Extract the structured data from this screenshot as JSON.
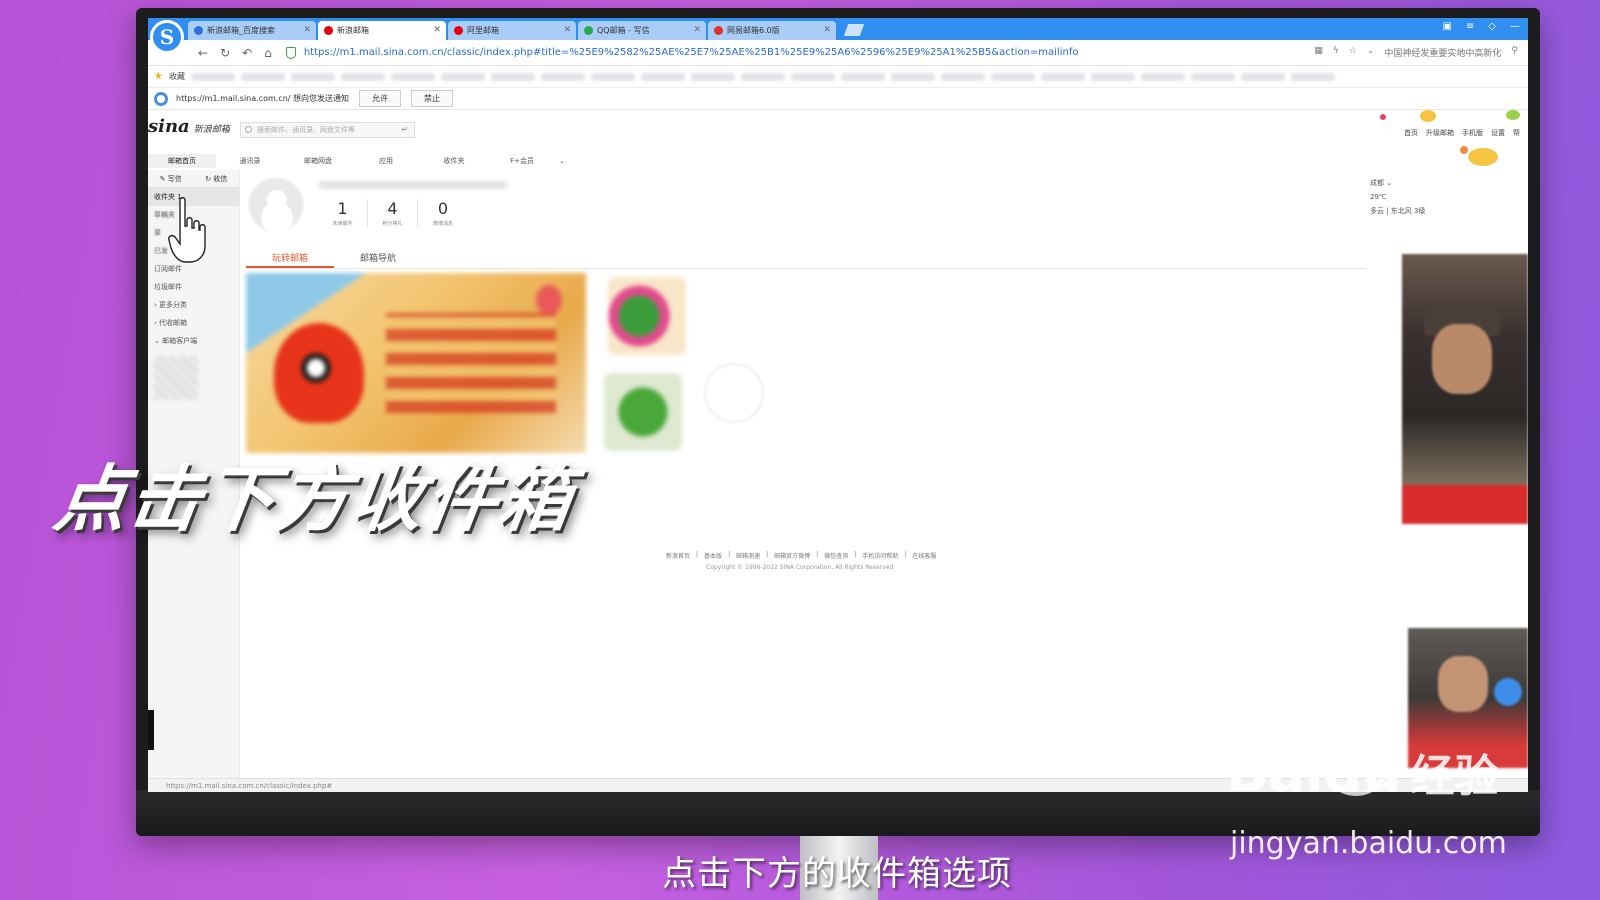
{
  "browser": {
    "logo": "S",
    "tabs": [
      {
        "label": "新浪邮箱_百度搜索",
        "active": false,
        "icon_color": "#2f6ee0"
      },
      {
        "label": "新浪邮箱",
        "active": true,
        "icon_color": "#e60012"
      },
      {
        "label": "阿里邮箱",
        "active": false,
        "icon_color": "#e60012"
      },
      {
        "label": "QQ邮箱 - 写信",
        "active": false,
        "icon_color": "#2aa84f"
      },
      {
        "label": "网易邮箱6.0版",
        "active": false,
        "icon_color": "#e0312a"
      }
    ],
    "url": "https://m1.mail.sina.com.cn/classic/index.php#title=%25E9%2582%25AE%25E7%25AE%25B1%25E9%25A6%2596%25E9%25A1%25B5&action=mailinfo",
    "nav_right_text": "中国神经发重要实地中高新化",
    "bookmarks_label": "收藏",
    "notify": {
      "text": "https://m1.mail.sina.com.cn/ 想向您发送通知",
      "allow": "允许",
      "deny": "禁止"
    },
    "status_url": "https://m1.mail.sina.com.cn/classic/index.php#"
  },
  "mail": {
    "logo_word": "sina",
    "logo_sub": "新浪邮箱",
    "search_placeholder": "搜索邮件、通讯录、网盘文件等",
    "top_links": [
      "首页",
      "升级邮箱",
      "手机版",
      "设置",
      "帮"
    ],
    "tabs": [
      "邮箱首页",
      "通讯录",
      "邮箱网盘",
      "应用",
      "收件夹",
      "F+会员"
    ],
    "compose": "写信",
    "receive": "收信",
    "folders": [
      {
        "label": "收件夹  1",
        "active": true
      },
      {
        "label": "草稿夹",
        "active": false
      },
      {
        "label": "草",
        "active": false
      },
      {
        "label": "已发",
        "active": false
      },
      {
        "label": "订阅邮件",
        "active": false
      },
      {
        "label": "垃圾邮件",
        "active": false
      },
      {
        "label": "› 更多分类",
        "active": false
      },
      {
        "label": "› 代收邮箱",
        "active": false
      },
      {
        "label": "⌄ 邮箱客户端",
        "active": false
      }
    ],
    "stats": [
      {
        "value": "1",
        "label": "未读邮件"
      },
      {
        "value": "4",
        "label": "积分换礼"
      },
      {
        "value": "0",
        "label": "微博消息"
      }
    ],
    "subtabs": [
      "玩转邮箱",
      "邮箱导航"
    ],
    "footer_links": [
      "新浪首页",
      "|",
      "基本版",
      "|",
      "邮箱测速",
      "|",
      "邮箱官方微博",
      "|",
      "微信查询",
      "|",
      "手机访问帮助",
      "|",
      "在线客服"
    ],
    "copyright": "Copyright © 1996-2022 SINA Corporation, All Rights Reserved",
    "weather": {
      "city": "成都 ⌄",
      "temp": "29℃",
      "desc": "多云 | 东北风 3级"
    }
  },
  "overlay": {
    "title": "点击下方收件箱",
    "subtitle": "点击下方的收件箱选项",
    "watermark": "Bai",
    "watermark_du": "du",
    "watermark_cn": "经验",
    "watermark_url": "jingyan.baidu.com"
  },
  "colors": {
    "accent": "#e8572f",
    "browser_blue": "#2f8ef0",
    "background": "#b552d6"
  }
}
